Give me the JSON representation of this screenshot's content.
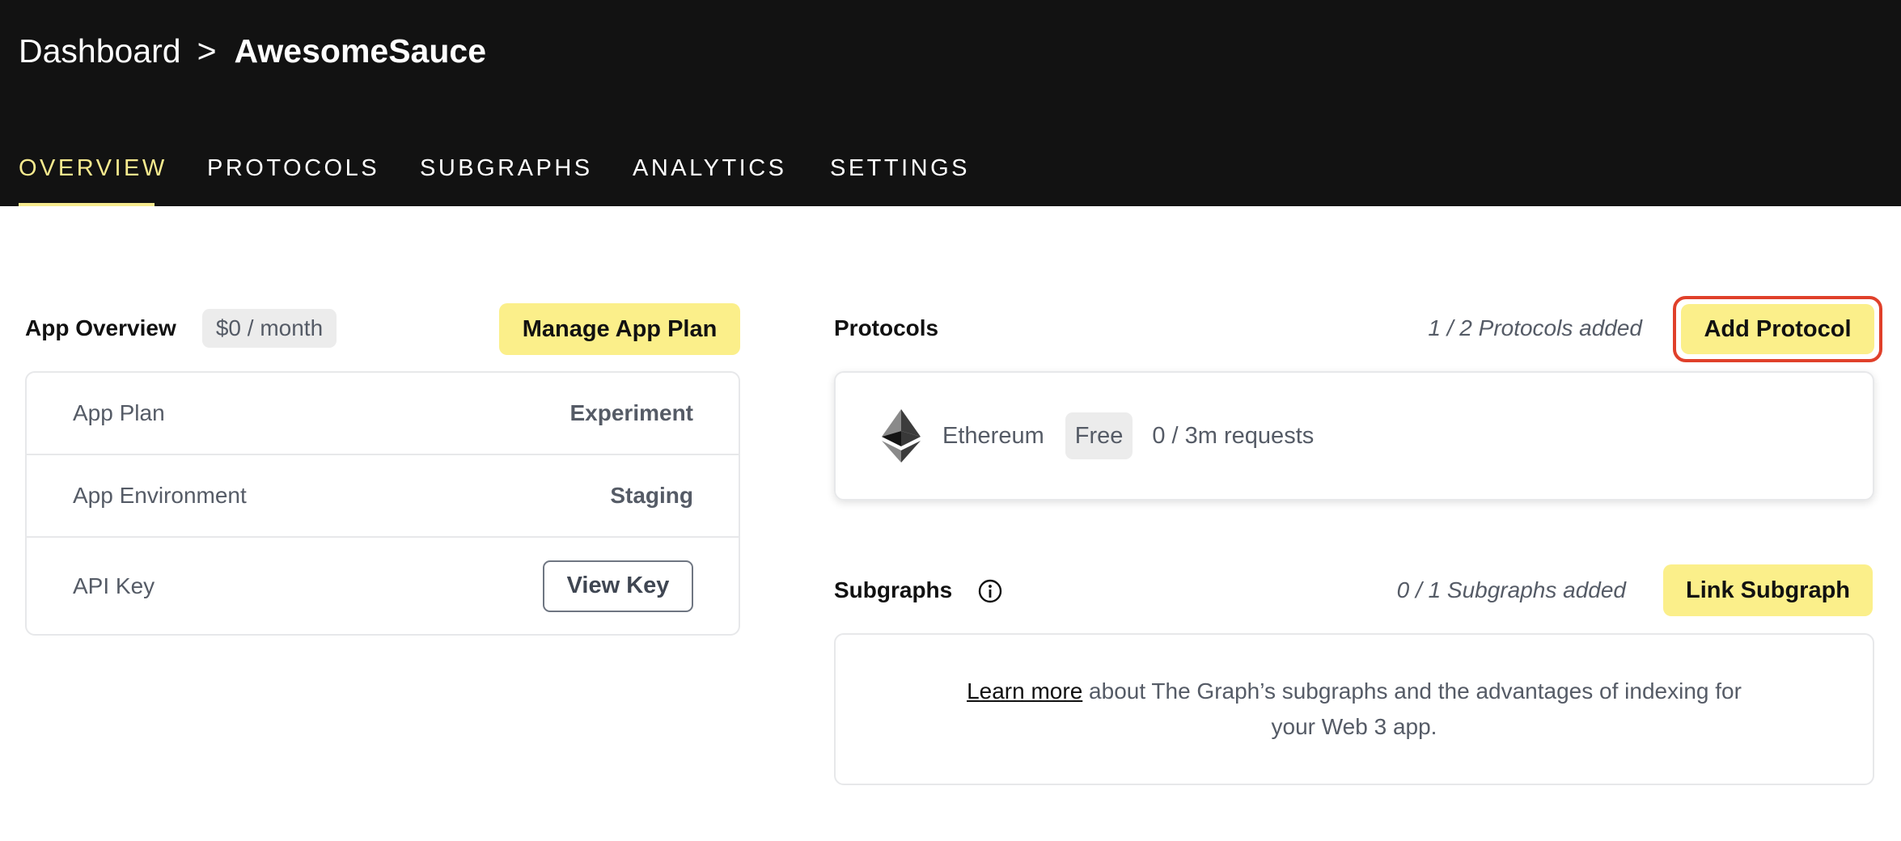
{
  "header": {
    "breadcrumb": {
      "parent": "Dashboard",
      "separator": ">",
      "current": "AwesomeSauce"
    },
    "tabs": [
      {
        "label": "OVERVIEW",
        "active": true
      },
      {
        "label": "PROTOCOLS",
        "active": false
      },
      {
        "label": "SUBGRAPHS",
        "active": false
      },
      {
        "label": "ANALYTICS",
        "active": false
      },
      {
        "label": "SETTINGS",
        "active": false
      }
    ]
  },
  "app_overview": {
    "title": "App Overview",
    "price": "$0 / month",
    "manage_button": "Manage App Plan",
    "rows": [
      {
        "label": "App Plan",
        "value": "Experiment"
      },
      {
        "label": "App Environment",
        "value": "Staging"
      },
      {
        "label": "API Key",
        "button": "View Key"
      }
    ]
  },
  "protocols": {
    "title": "Protocols",
    "count": "1 / 2 Protocols added",
    "add_button": "Add Protocol",
    "items": [
      {
        "icon": "ethereum-icon",
        "name": "Ethereum",
        "tier": "Free",
        "usage": "0 / 3m requests"
      }
    ]
  },
  "subgraphs": {
    "title": "Subgraphs",
    "info_icon": "info-icon",
    "count": "0 / 1 Subgraphs added",
    "link_button": "Link Subgraph",
    "learn_more": "Learn more",
    "description": " about The Graph’s subgraphs and the advantages of indexing for your Web 3 app."
  },
  "colors": {
    "header_bg": "#121212",
    "accent_yellow": "#fbef8a",
    "active_tab": "#f6ea8e",
    "highlight_outline": "#e0402a"
  }
}
